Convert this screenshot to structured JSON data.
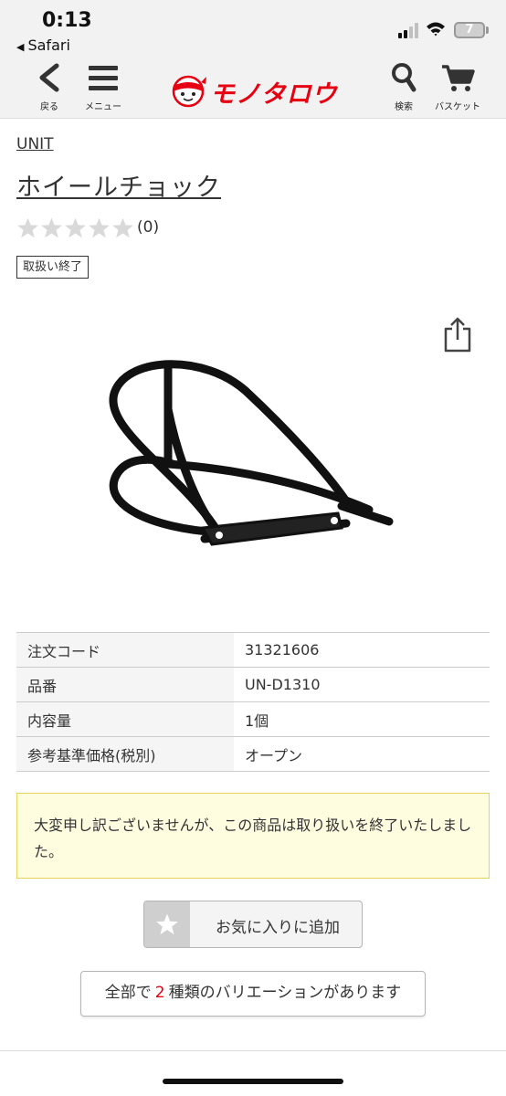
{
  "status_bar": {
    "time": "0:13",
    "back_app": "Safari",
    "battery": "7"
  },
  "nav": {
    "back_label": "戻る",
    "menu_label": "メニュー",
    "logo_text": "モノタロウ",
    "search_label": "検索",
    "basket_label": "バスケット",
    "brand_color": "#e60012"
  },
  "product": {
    "brand": "UNIT",
    "title": "ホイールチョック",
    "rating_stars": 0,
    "review_count": "(0)",
    "status_badge": "取扱い終了"
  },
  "specs": {
    "rows": [
      {
        "label": "注文コード",
        "value": "31321606"
      },
      {
        "label": "品番",
        "value": "UN-D1310"
      },
      {
        "label": "内容量",
        "value": "1個"
      },
      {
        "label": "参考基準価格(税別)",
        "value": "オープン"
      }
    ]
  },
  "notice": {
    "text": "大変申し訳ございませんが、この商品は取り扱いを終了いたしました。"
  },
  "favorite": {
    "label": "お気に入りに追加"
  },
  "variations": {
    "prefix": "全部で",
    "count": "2",
    "suffix": "種類のバリエーションがあります"
  }
}
